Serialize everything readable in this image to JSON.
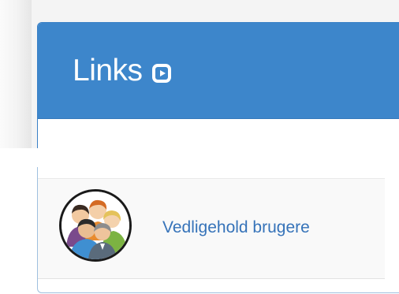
{
  "panel": {
    "title": "Links",
    "title_icon": "play-square-icon",
    "header_color": "#3d86cb"
  },
  "links": [
    {
      "label": "Vedligehold brugere",
      "icon": "users-group-avatar-icon",
      "color": "#3673b9"
    }
  ]
}
